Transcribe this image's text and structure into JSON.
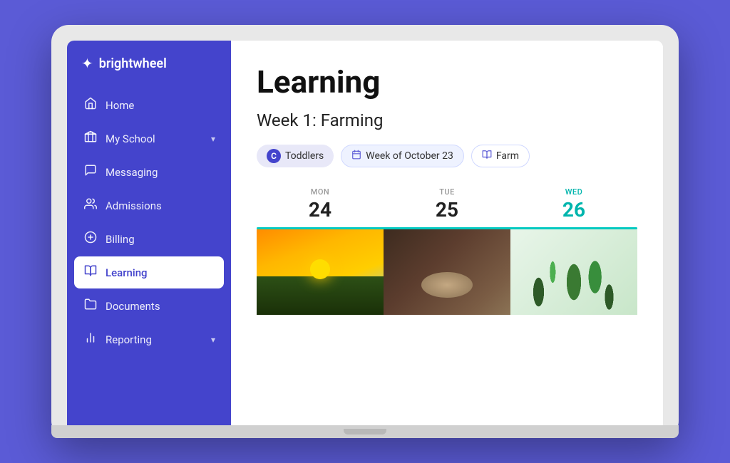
{
  "app": {
    "name": "brightwheel"
  },
  "sidebar": {
    "logo": "✦",
    "items": [
      {
        "id": "home",
        "label": "Home",
        "icon": "🏠",
        "active": false,
        "hasChevron": false
      },
      {
        "id": "my-school",
        "label": "My School",
        "icon": "🏫",
        "active": false,
        "hasChevron": true
      },
      {
        "id": "messaging",
        "label": "Messaging",
        "icon": "💬",
        "active": false,
        "hasChevron": false
      },
      {
        "id": "admissions",
        "label": "Admissions",
        "icon": "👥",
        "active": false,
        "hasChevron": false
      },
      {
        "id": "billing",
        "label": "Billing",
        "icon": "💰",
        "active": false,
        "hasChevron": false
      },
      {
        "id": "learning",
        "label": "Learning",
        "icon": "📖",
        "active": true,
        "hasChevron": false
      },
      {
        "id": "documents",
        "label": "Documents",
        "icon": "🗂️",
        "active": false,
        "hasChevron": false
      },
      {
        "id": "reporting",
        "label": "Reporting",
        "icon": "📊",
        "active": false,
        "hasChevron": true
      }
    ]
  },
  "main": {
    "page_title": "Learning",
    "week_title": "Week 1: Farming",
    "filters": {
      "class": "Toddlers",
      "class_letter": "C",
      "date": "Week of October 23",
      "theme": "Farm"
    },
    "days": [
      {
        "name": "MON",
        "number": "24",
        "today": false
      },
      {
        "name": "TUE",
        "number": "25",
        "today": false
      },
      {
        "name": "WED",
        "number": "26",
        "today": true
      }
    ]
  }
}
